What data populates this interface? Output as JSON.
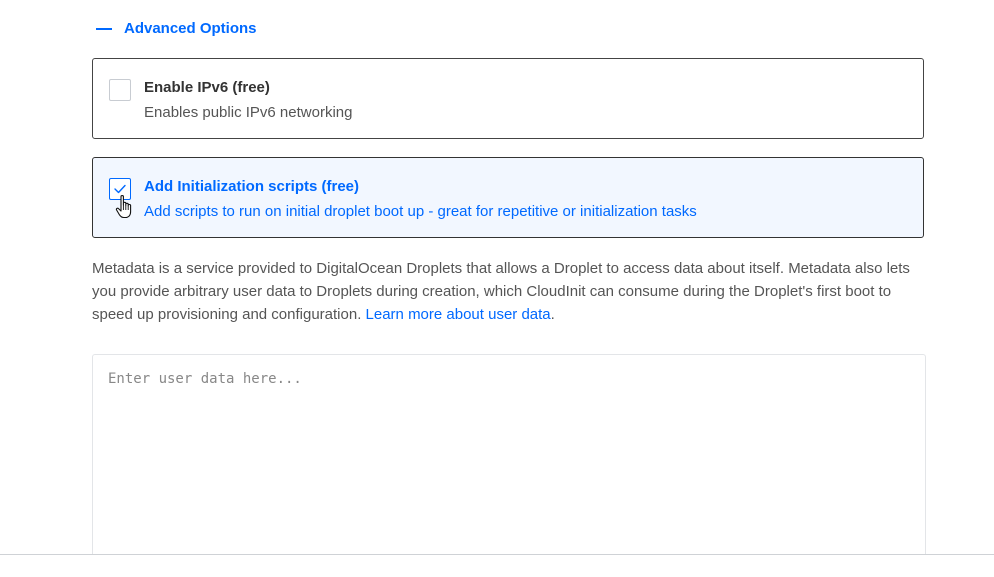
{
  "advanced_options": {
    "toggle_label": "Advanced Options",
    "expanded": true
  },
  "options": [
    {
      "title": "Enable IPv6 (free)",
      "description": "Enables public IPv6 networking",
      "checked": false
    },
    {
      "title": "Add Initialization scripts (free)",
      "description": "Add scripts to run on initial droplet boot up - great for repetitive or initialization tasks",
      "checked": true
    }
  ],
  "metadata_info": {
    "text": "Metadata is a service provided to DigitalOcean Droplets that allows a Droplet to access data about itself. Metadata also lets you provide arbitrary user data to Droplets during creation, which CloudInit can consume during the Droplet's first boot to speed up provisioning and configuration.",
    "link_text": "Learn more about user data",
    "trailing": "."
  },
  "user_data": {
    "value": "",
    "placeholder": "Enter user data here..."
  },
  "colors": {
    "accent": "#0069ff",
    "selected_card_bg": "#f2f7ff",
    "body_text": "#555555"
  },
  "icons": {
    "toggle": "minus-icon",
    "check": "checkmark-icon",
    "pointer": "hand-pointer-cursor"
  }
}
